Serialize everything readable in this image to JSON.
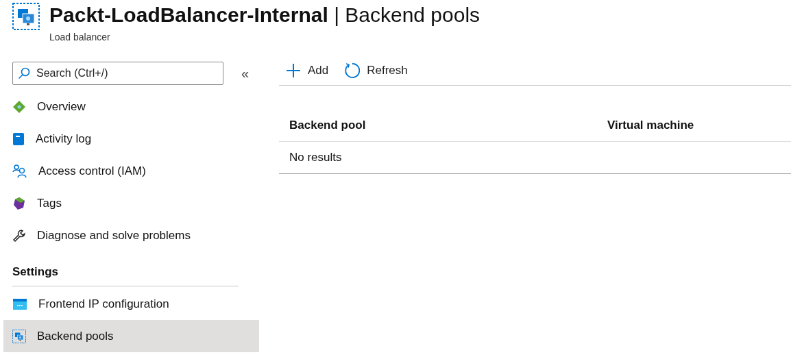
{
  "header": {
    "title": "**Packt-LoadBalancer-Internal** | Backend pools",
    "subtitle": "Load balancer"
  },
  "sidebar": {
    "search": {
      "placeholder": "Search (Ctrl+/)"
    },
    "collapse": "«",
    "groups": [
      {
        "items": [
          {
            "label": "Overview",
            "kind": "overview",
            "selected": false
          },
          {
            "label": "Activity log",
            "kind": "log",
            "selected": false
          },
          {
            "label": "Access control (IAM)",
            "kind": "people",
            "selected": false
          },
          {
            "label": "Tags",
            "kind": "tag",
            "selected": false
          },
          {
            "label": "Diagnose and solve problems",
            "kind": "wrench",
            "selected": false
          }
        ]
      },
      {
        "heading": "Settings",
        "items": [
          {
            "label": "Frontend IP configuration",
            "kind": "frontend",
            "selected": false
          },
          {
            "label": "Backend pools",
            "kind": "pool",
            "selected": true
          }
        ]
      }
    ]
  },
  "toolbar": [
    {
      "label": "Add",
      "kind": "add"
    },
    {
      "label": "Refresh",
      "kind": "refresh"
    }
  ],
  "table": {
    "columns": [
      "Backend pool",
      "Virtual machine"
    ],
    "empty": "No results"
  }
}
